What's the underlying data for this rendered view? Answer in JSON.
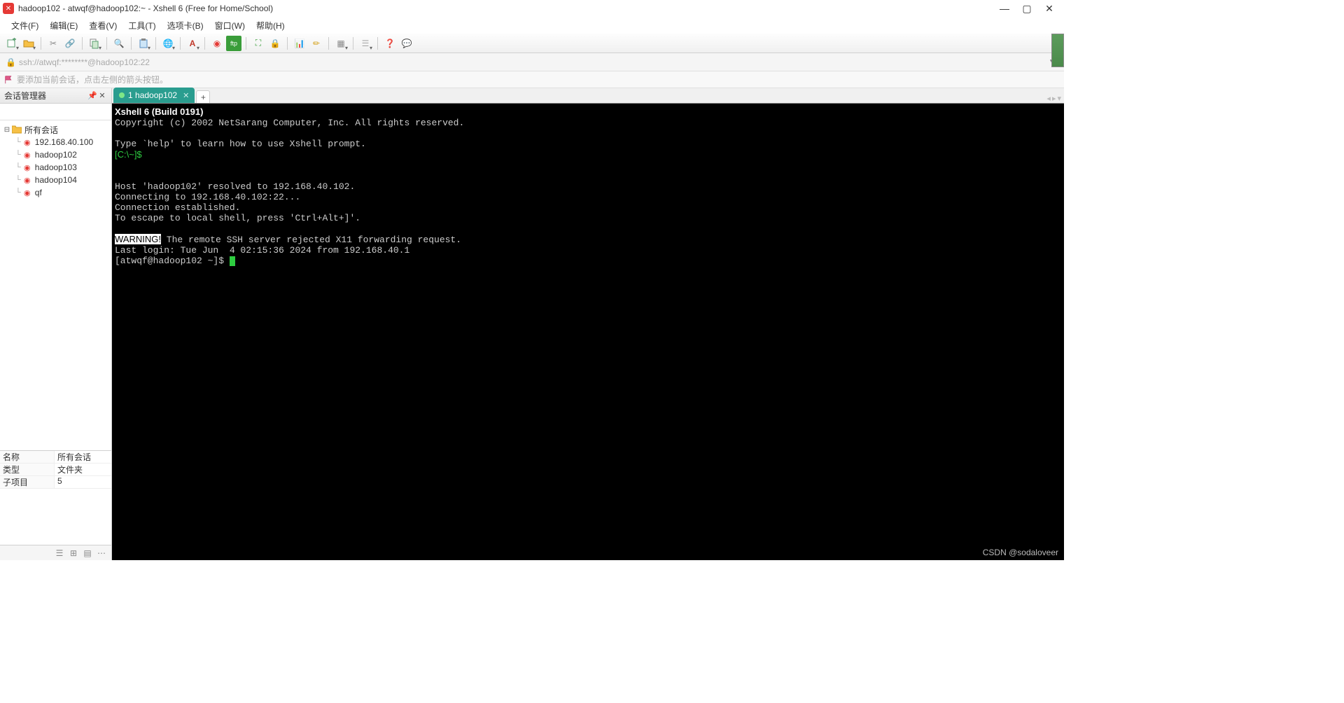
{
  "titlebar": {
    "text": "hadoop102 - atwqf@hadoop102:~ - Xshell 6 (Free for Home/School)"
  },
  "menubar": {
    "items": [
      "文件(F)",
      "编辑(E)",
      "查看(V)",
      "工具(T)",
      "选项卡(B)",
      "窗口(W)",
      "帮助(H)"
    ]
  },
  "addressbar": {
    "text": "ssh://atwqf:********@hadoop102:22"
  },
  "hintbar": {
    "text": "要添加当前会话，点击左侧的箭头按钮。"
  },
  "sidebar": {
    "title": "会话管理器",
    "search_placeholder": "",
    "tree": {
      "root_label": "所有会话",
      "items": [
        {
          "label": "192.168.40.100"
        },
        {
          "label": "hadoop102"
        },
        {
          "label": "hadoop103"
        },
        {
          "label": "hadoop104"
        },
        {
          "label": "qf"
        }
      ]
    },
    "props": [
      {
        "k": "名称",
        "v": "所有会话"
      },
      {
        "k": "类型",
        "v": "文件夹"
      },
      {
        "k": "子项目",
        "v": "5"
      }
    ]
  },
  "tabs": {
    "active": {
      "index_label": "1",
      "label": "hadoop102"
    }
  },
  "terminal": {
    "lines": [
      {
        "type": "bold",
        "text": "Xshell 6 (Build 0191)"
      },
      {
        "type": "plain",
        "text": "Copyright (c) 2002 NetSarang Computer, Inc. All rights reserved."
      },
      {
        "type": "blank",
        "text": ""
      },
      {
        "type": "plain",
        "text": "Type `help' to learn how to use Xshell prompt."
      },
      {
        "type": "green",
        "text": "[C:\\~]$"
      },
      {
        "type": "blank",
        "text": ""
      },
      {
        "type": "blank",
        "text": ""
      },
      {
        "type": "plain",
        "text": "Host 'hadoop102' resolved to 192.168.40.102."
      },
      {
        "type": "plain",
        "text": "Connecting to 192.168.40.102:22..."
      },
      {
        "type": "plain",
        "text": "Connection established."
      },
      {
        "type": "plain",
        "text": "To escape to local shell, press 'Ctrl+Alt+]'."
      },
      {
        "type": "blank",
        "text": ""
      },
      {
        "type": "warning",
        "prefix": "WARNING!",
        "text": " The remote SSH server rejected X11 forwarding request."
      },
      {
        "type": "plain",
        "text": "Last login: Tue Jun  4 02:15:36 2024 from 192.168.40.1"
      },
      {
        "type": "prompt",
        "text": "[atwqf@hadoop102 ~]$ "
      }
    ]
  },
  "watermark": {
    "text": "CSDN @sodaloveer"
  }
}
